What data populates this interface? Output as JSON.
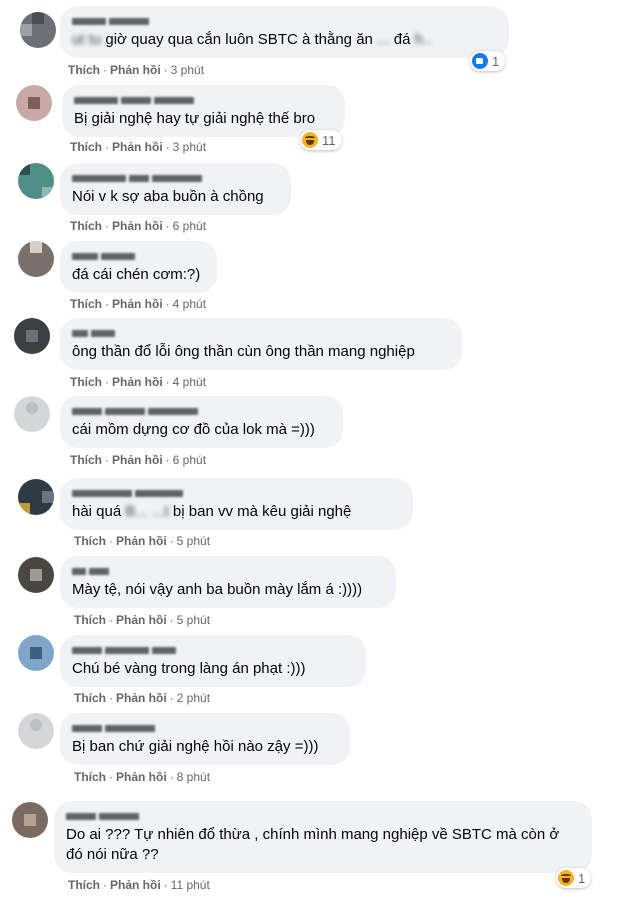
{
  "actions": {
    "like": "Thích",
    "reply": "Phản hồi",
    "sep": "·"
  },
  "comments": [
    {
      "text_plain": "giờ quay qua cắn luôn SBTC à thằng ăn",
      "text_blur_pre": "ut tu",
      "text_blur_mid": "...",
      "text_after": "đá",
      "text_blur_end": "h..",
      "time": "3 phút",
      "reaction": {
        "icon": "like-icon",
        "count": "1"
      }
    },
    {
      "text": "Bị giải nghệ hay tự giải nghệ thế bro",
      "time": "3 phút",
      "reaction": {
        "icon": "haha-icon",
        "count": "11"
      }
    },
    {
      "text": "Nói v k sợ aba buồn à chồng",
      "time": "6 phút"
    },
    {
      "text": "đá cái chén cơm:?)",
      "time": "4 phút"
    },
    {
      "text": "ông thần đổ lỗi ông thần cùn ông thần mang nghiệp",
      "time": "4 phút"
    },
    {
      "text": "cái mồm dựng cơ đồ của lok mà =)))",
      "time": "6 phút"
    },
    {
      "text_pre": "hài quá",
      "text_blur": "B... ...t",
      "text_post": "bị ban vv mà kêu giải nghệ",
      "time": "5 phút"
    },
    {
      "text": "Mày tệ, nói vậy anh ba buồn mày lắm á :))))",
      "time": "5 phút"
    },
    {
      "text": "Chú bé vàng trong làng án phạt :)))",
      "time": "2 phút"
    },
    {
      "text": "Bị ban chứ giải nghệ hồi nào zậy =)))",
      "time": "8 phút"
    },
    {
      "text": "Do ai ??? Tự nhiên đổ thừa , chính mình mang nghiệp về SBTC mà còn ở đó nói nữa ??",
      "time": "11 phút",
      "reaction": {
        "icon": "haha-icon",
        "count": "1"
      }
    }
  ]
}
